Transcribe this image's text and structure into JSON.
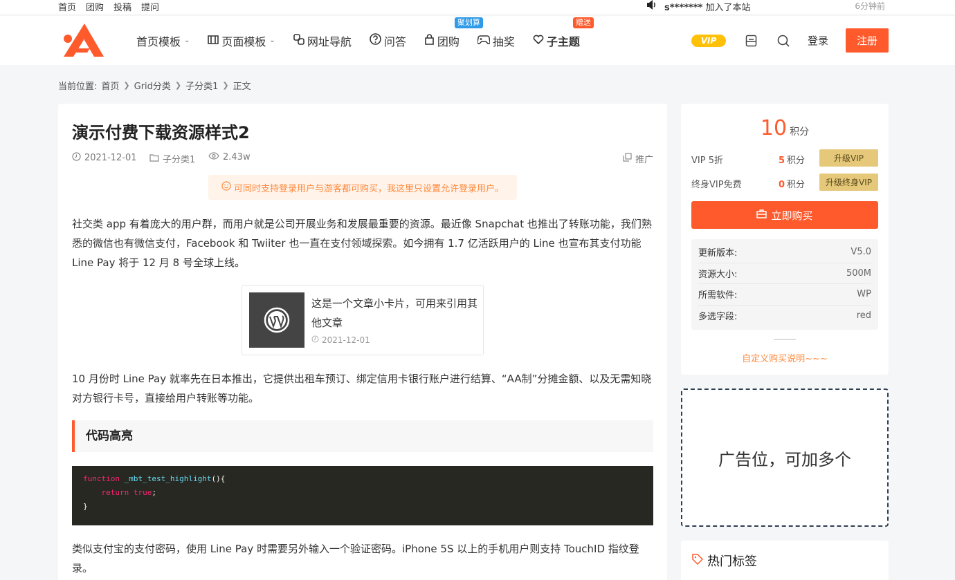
{
  "topbar": {
    "links": [
      "首页",
      "团购",
      "投稿",
      "提问"
    ],
    "notice_user": "s*******",
    "notice_text": "加入了本站",
    "time": "6分钟前"
  },
  "nav": {
    "items": [
      {
        "label": "首页模板",
        "icon": "grid-icon",
        "dropdown": true
      },
      {
        "label": "页面模板",
        "icon": "columns-icon",
        "dropdown": true
      },
      {
        "label": "网址导航",
        "icon": "link-icon"
      },
      {
        "label": "问答",
        "icon": "question-circle-icon"
      },
      {
        "label": "团购",
        "icon": "shopping-bag-icon",
        "badge": "聚划算",
        "badge_color": "#2e9ae8"
      },
      {
        "label": "抽奖",
        "icon": "gamepad-icon"
      },
      {
        "label": "子主题",
        "icon": "heart-icon",
        "badge": "赠送",
        "badge_color": "#ff5a2c"
      }
    ],
    "vip_pill": "VIP",
    "login": "登录",
    "register": "注册"
  },
  "breadcrumb": {
    "prefix": "当前位置:",
    "items": [
      "首页",
      "Grid分类",
      "子分类1",
      "正文"
    ]
  },
  "article": {
    "title": "演示付费下载资源样式2",
    "date": "2021-12-01",
    "category": "子分类1",
    "views": "2.43w",
    "promo": "推广",
    "notice": "可同时支持登录用户与游客都可购买，我这里只设置允许登录用户。",
    "para1": "社交类 app 有着庞大的用户群，而用户就是公司开展业务和发展最重要的资源。最近像 Snapchat 也推出了转账功能，我们熟悉的微信也有微信支付，Facebook 和 Twiiter 也一直在支付领域探索。如今拥有 1.7 亿活跃用户的 Line 也宣布其支付功能 Line Pay 将于 12 月 8 号全球上线。",
    "card_title": "这是一个文章小卡片，可用来引用其他文章",
    "card_date": "2021-12-01",
    "para2": "10 月份时 Line Pay 就率先在日本推出，它提供出租车预订、绑定信用卡银行账户进行结算、“AA制”分摊金额、以及无需知晓对方银行卡号，直接给用户转账等功能。",
    "heading": "代码高亮",
    "code": {
      "kw1": "function",
      "fn": "_mbt_test_highlight",
      "paren": "(){",
      "kw2": "return",
      "val": "true",
      "semi": ";",
      "close": "}"
    },
    "para3": "类似支付宝的支付密码，使用 Line Pay 时需要另外输入一个验证密码。iPhone 5S 以上的手机用户则支持 TouchID 指纹登录。"
  },
  "purchase": {
    "price": "10",
    "unit": "积分",
    "rows": [
      {
        "label": "VIP 5折",
        "value": "5",
        "unit": "积分",
        "button": "升级VIP"
      },
      {
        "label": "终身VIP免费",
        "value": "0",
        "unit": "积分",
        "button": "升级终身VIP"
      }
    ],
    "buy": "立即购买",
    "specs": [
      {
        "key": "更新版本:",
        "value": "V5.0"
      },
      {
        "key": "资源大小:",
        "value": "500M"
      },
      {
        "key": "所需软件:",
        "value": "WP"
      },
      {
        "key": "多选字段:",
        "value": "red"
      }
    ],
    "custom_note": "自定义购买说明~~~"
  },
  "ad": {
    "text": "广告位，可加多个"
  },
  "tags": {
    "title": "热门标签"
  },
  "colors": {
    "accent": "#ff5a2c",
    "vip_gold": "#e5c87a",
    "badge_blue": "#2e9ae8"
  }
}
